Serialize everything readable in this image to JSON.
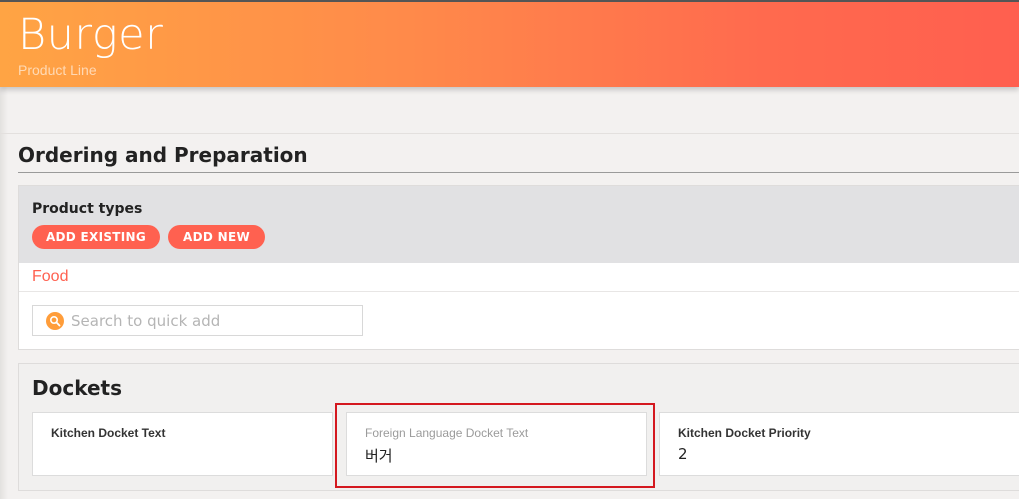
{
  "header": {
    "title": "Burger",
    "subtitle": "Product Line"
  },
  "section": {
    "title": "Ordering and Preparation"
  },
  "product_types": {
    "label": "Product types",
    "add_existing_label": "ADD EXISTING",
    "add_new_label": "ADD NEW",
    "items": [
      "Food"
    ],
    "search_placeholder": "Search to quick add"
  },
  "dockets": {
    "title": "Dockets",
    "fields": [
      {
        "label": "Kitchen Docket Text",
        "value": ""
      },
      {
        "label": "Foreign Language Docket Text",
        "value": "버거"
      },
      {
        "label": "Kitchen Docket Priority",
        "value": "2"
      }
    ]
  },
  "colors": {
    "header_gradient_start": "#ffa444",
    "header_gradient_end": "#ff5f4f",
    "accent": "#ff6150",
    "search_icon": "#ff9d3a",
    "highlight_box": "#d4181f"
  },
  "icons": {
    "search": "search-icon"
  }
}
